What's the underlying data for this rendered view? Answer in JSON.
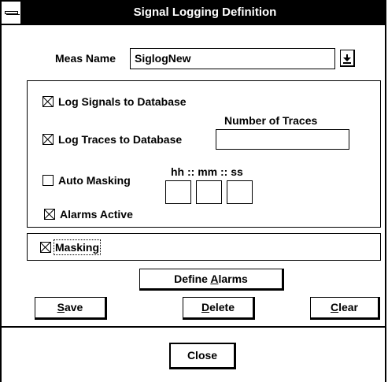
{
  "window": {
    "title": "Signal Logging Definition"
  },
  "meas_name": {
    "label": "Meas Name",
    "value": "SiglogNew"
  },
  "options": {
    "log_signals": {
      "label": "Log Signals to Database",
      "checked": true
    },
    "log_traces": {
      "label": "Log Traces to Database",
      "checked": true
    },
    "number_of_traces": {
      "label": "Number of Traces",
      "value": ""
    },
    "auto_masking": {
      "label": "Auto Masking",
      "checked": false
    },
    "time": {
      "label": "hh :: mm :: ss",
      "hh": "",
      "mm": "",
      "ss": ""
    },
    "alarms_active": {
      "label": "Alarms Active",
      "checked": true
    }
  },
  "masking": {
    "label": "Masking",
    "checked": true
  },
  "buttons": {
    "define_alarms": {
      "pre": "Define ",
      "accel": "A",
      "post": "larms"
    },
    "save": {
      "pre": "",
      "accel": "S",
      "post": "ave"
    },
    "delete": {
      "pre": "",
      "accel": "D",
      "post": "elete"
    },
    "clear": {
      "pre": "",
      "accel": "C",
      "post": "lear"
    },
    "close": {
      "label": "Close"
    }
  }
}
